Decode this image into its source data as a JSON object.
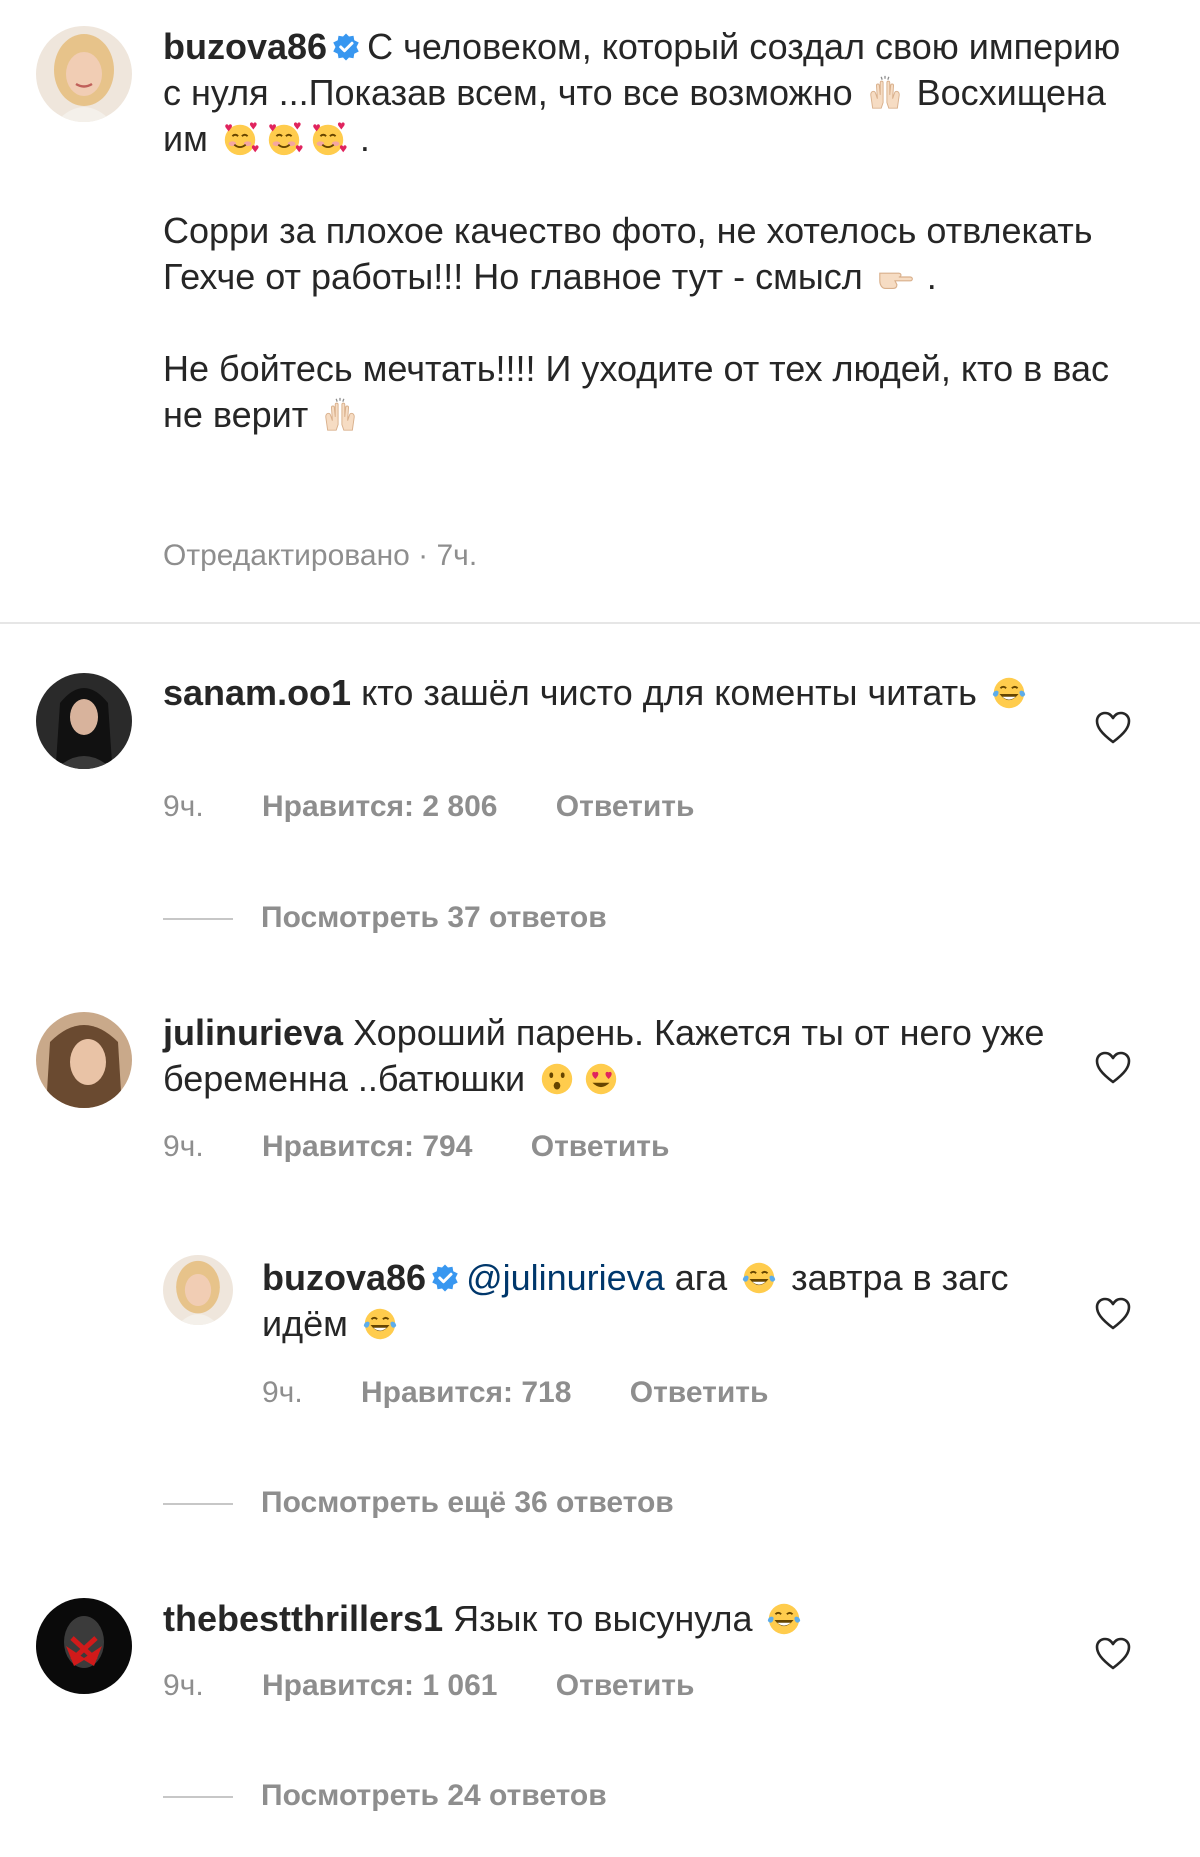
{
  "post": {
    "username": "buzova86",
    "caption_line1": "С человеком, который создал свою империю с нуля ...Показав всем, что все возможно",
    "caption_line1b": "Восхищена им",
    "caption_line1c": ".",
    "caption_para2": "Сорри за плохое качество фото, не хотелось отвлекать Гехче от работы!!! Но главное тут - смысл",
    "caption_para2b": ".",
    "caption_para3": "Не бойтесь мечтать!!!! И уходите от тех людей, кто в вас не верит",
    "meta": "Отредактировано · 7ч."
  },
  "comments": [
    {
      "username": "sanam.oo1",
      "text": "кто зашёл чисто для коменты читать",
      "time": "9ч.",
      "likes": "Нравится: 2 806",
      "reply": "Ответить",
      "view_replies": "Посмотреть 37 ответов"
    },
    {
      "username": "julinurieva",
      "text": "Хороший парень. Кажется ты от него уже беременна ..батюшки",
      "time": "9ч.",
      "likes": "Нравится: 794",
      "reply": "Ответить"
    },
    {
      "username": "buzova86",
      "mention": "@julinurieva",
      "text_a": "ага",
      "text_b": "завтра в загс идём",
      "time": "9ч.",
      "likes": "Нравится: 718",
      "reply": "Ответить",
      "view_replies": "Посмотреть ещё 36 ответов"
    },
    {
      "username": "thebestthrillers1",
      "text": "Язык то высунула",
      "time": "9ч.",
      "likes": "Нравится: 1 061",
      "reply": "Ответить",
      "view_replies": "Посмотреть 24 ответов"
    }
  ],
  "icons": {
    "verified": "verified-badge-icon",
    "heart": "heart-outline-icon",
    "raising_hands": "raising-hands-emoji",
    "smiling_hearts": "smiling-face-with-hearts-emoji",
    "pointing_right": "backhand-index-pointing-right-emoji",
    "tears_of_joy": "face-with-tears-of-joy-emoji",
    "hushed": "hushed-face-emoji",
    "heart_eyes": "heart-eyes-emoji"
  },
  "colors": {
    "verified": "#3897f0",
    "meta_gray": "#8e8e8e",
    "mention": "#00376b"
  }
}
